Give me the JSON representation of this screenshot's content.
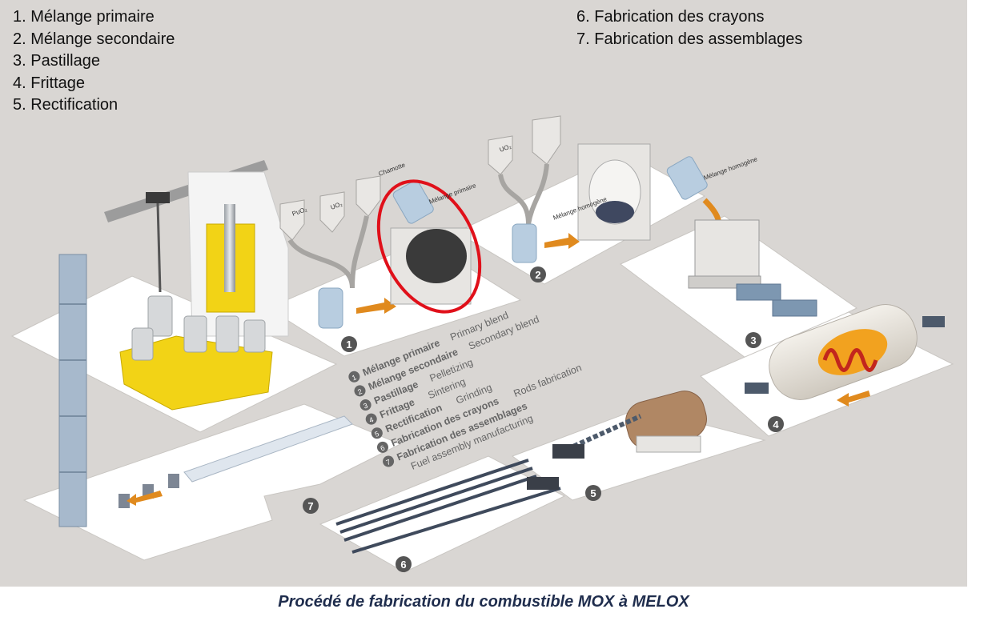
{
  "legend_left": [
    "1. Mélange primaire",
    "2. Mélange secondaire",
    "3. Pastillage",
    "4. Frittage",
    "5. Rectification"
  ],
  "legend_right": [
    "6. Fabrication des crayons",
    "7. Fabrication des assemblages"
  ],
  "diagram_steps": [
    {
      "num": "1",
      "fr": "Mélange primaire",
      "en": "Primary blend"
    },
    {
      "num": "2",
      "fr": "Mélange secondaire",
      "en": "Secondary blend"
    },
    {
      "num": "3",
      "fr": "Pastillage",
      "en": "Pelletizing"
    },
    {
      "num": "4",
      "fr": "Frittage",
      "en": "Sintering"
    },
    {
      "num": "5",
      "fr": "Rectification",
      "en": "Grinding"
    },
    {
      "num": "6",
      "fr": "Fabrication des crayons",
      "en": "Rods fabrication"
    },
    {
      "num": "7",
      "fr": "Fabrication des assemblages",
      "en": "Fuel assembly manufacturing"
    }
  ],
  "station_labels": {
    "puo2": "PuO₂",
    "uo2": "UO₂",
    "chamotte": "Chamotte",
    "melange_primaire": "Mélange primaire",
    "uo2_2": "UO₂",
    "melange_homogene": "Mélange homogène"
  },
  "highlight_color": "#e0101a",
  "arrow_color": "#e08a1e",
  "caption": "Procédé de fabrication du combustible MOX à MELOX"
}
